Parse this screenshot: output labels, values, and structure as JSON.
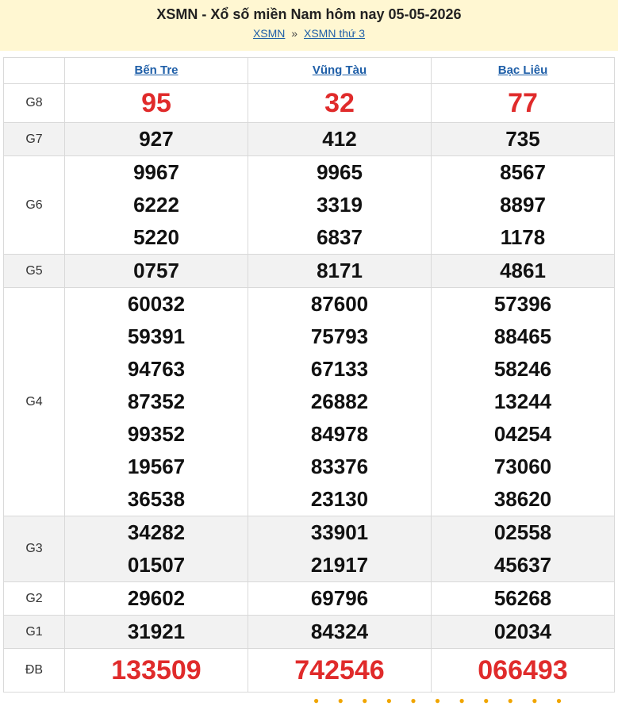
{
  "header": {
    "title": "XSMN - Xổ số miền Nam hôm nay 05-05-2026",
    "crumb_home": "XSMN",
    "crumb_sep": "»",
    "crumb_current": "XSMN thứ 3"
  },
  "colors": {
    "header_bg": "#fff7d2",
    "link": "#1f5fa8",
    "highlight_red": "#e02b2b",
    "alt_row": "#f2f2f2"
  },
  "provinces": [
    "Bến Tre",
    "Vũng Tàu",
    "Bạc Liêu"
  ],
  "rows": [
    {
      "label": "G8",
      "values": [
        [
          "95"
        ],
        [
          "32"
        ],
        [
          "77"
        ]
      ]
    },
    {
      "label": "G7",
      "values": [
        [
          "927"
        ],
        [
          "412"
        ],
        [
          "735"
        ]
      ]
    },
    {
      "label": "G6",
      "values": [
        [
          "9967",
          "6222",
          "5220"
        ],
        [
          "9965",
          "3319",
          "6837"
        ],
        [
          "8567",
          "8897",
          "1178"
        ]
      ]
    },
    {
      "label": "G5",
      "values": [
        [
          "0757"
        ],
        [
          "8171"
        ],
        [
          "4861"
        ]
      ]
    },
    {
      "label": "G4",
      "values": [
        [
          "60032",
          "59391",
          "94763",
          "87352",
          "99352",
          "19567",
          "36538"
        ],
        [
          "87600",
          "75793",
          "67133",
          "26882",
          "84978",
          "83376",
          "23130"
        ],
        [
          "57396",
          "88465",
          "58246",
          "13244",
          "04254",
          "73060",
          "38620"
        ]
      ]
    },
    {
      "label": "G3",
      "values": [
        [
          "34282",
          "01507"
        ],
        [
          "33901",
          "21917"
        ],
        [
          "02558",
          "45637"
        ]
      ]
    },
    {
      "label": "G2",
      "values": [
        [
          "29602"
        ],
        [
          "69796"
        ],
        [
          "56268"
        ]
      ]
    },
    {
      "label": "G1",
      "values": [
        [
          "31921"
        ],
        [
          "84324"
        ],
        [
          "02034"
        ]
      ]
    },
    {
      "label": "ĐB",
      "values": [
        [
          "133509"
        ],
        [
          "742546"
        ],
        [
          "066493"
        ]
      ]
    }
  ]
}
